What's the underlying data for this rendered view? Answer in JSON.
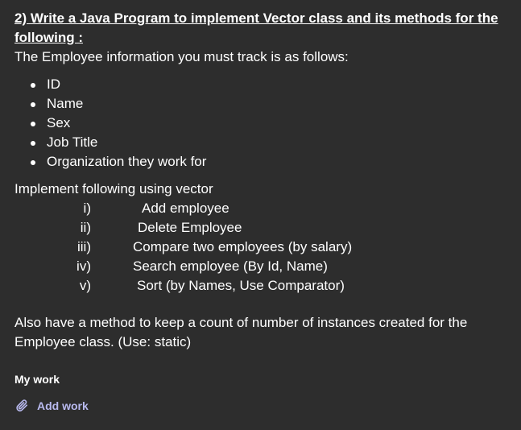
{
  "assignment": {
    "heading": "2)  Write a Java Program to implement Vector class and its methods for the following :",
    "intro": "The Employee information you must track is as follows:",
    "fields": [
      "ID",
      "Name",
      "Sex",
      "Job Title",
      "Organization they work for"
    ],
    "implement_title": "Implement following using vector",
    "tasks": [
      {
        "num": "i)",
        "text": "Add employee"
      },
      {
        "num": "ii)",
        "text": "Delete Employee"
      },
      {
        "num": "iii)",
        "text": "Compare two employees (by salary)"
      },
      {
        "num": "iv)",
        "text": "Search employee (By Id, Name)"
      },
      {
        "num": "v)",
        "text": "Sort (by Names, Use Comparator)"
      }
    ],
    "also": "Also have a method to keep a count of number of instances created for the Employee class. (Use: static)"
  },
  "my_work": {
    "title": "My work",
    "add_label": "Add work",
    "add_icon": "paperclip-icon",
    "accent": "#b8b9ee"
  }
}
